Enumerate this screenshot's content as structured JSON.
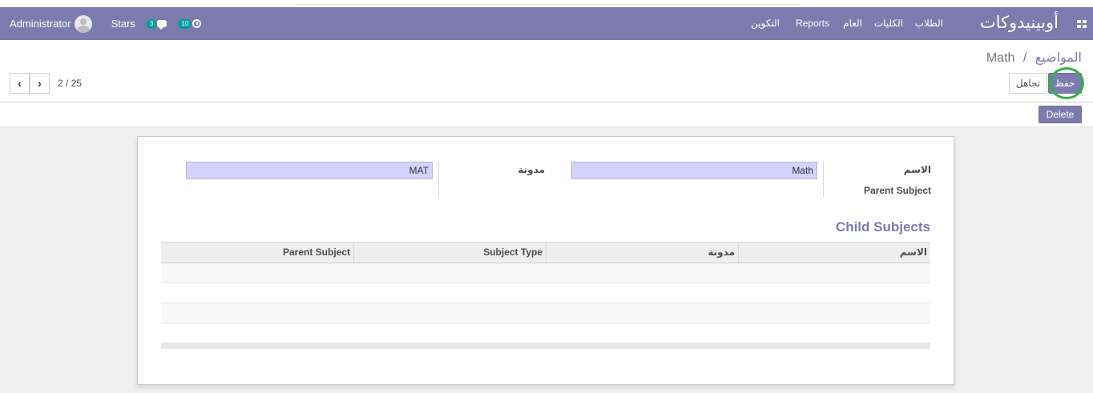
{
  "navbar": {
    "user": "Administrator",
    "stars": "Stars",
    "chat_badge": "3",
    "activity_badge": "10",
    "brand": "أوبينيدوكات",
    "menu": [
      "الطلاب",
      "الكليات",
      "العام",
      "Reports",
      "التكوين"
    ]
  },
  "breadcrumb": {
    "parent": "المواضيع",
    "separator": "/",
    "current": "Math"
  },
  "buttons": {
    "save": "حفظ",
    "discard": "تجاهل",
    "delete": "Delete"
  },
  "pager": {
    "prev": "‹",
    "next": "›",
    "value": "2 / 25"
  },
  "form": {
    "name_label": "الاسم",
    "name_value": "Math",
    "code_label": "مدونة",
    "code_value": "MAT",
    "parent_label": "Parent Subject",
    "section_title": "Child Subjects"
  },
  "table": {
    "columns": [
      "الاسم",
      "مدونة",
      "Subject Type",
      "Parent Subject"
    ],
    "rows": []
  },
  "colors": {
    "brand": "#7c7bad",
    "input_required": "#d2d2ff",
    "highlight_ring": "#2fb344"
  }
}
